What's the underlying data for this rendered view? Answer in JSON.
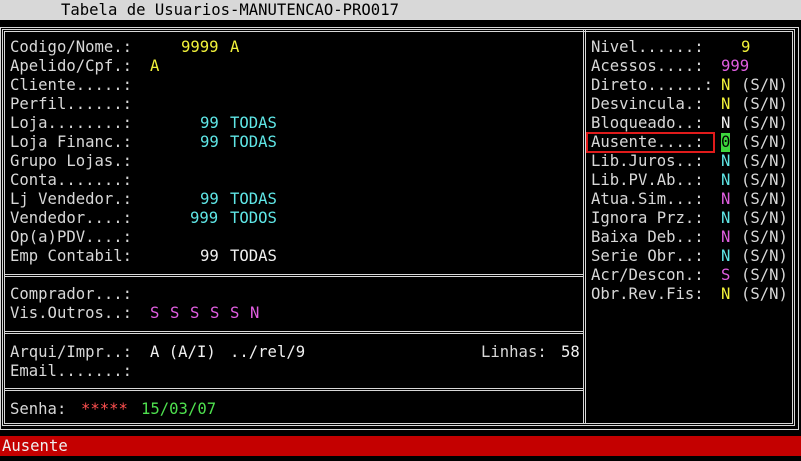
{
  "window": {
    "title": "Tabela de Usuarios-MANUTENCAO-PRO017"
  },
  "left": {
    "fields": [
      {
        "label": "Codigo/Nome.:",
        "value": "9999",
        "value2": "A"
      },
      {
        "label": "Apelido/Cpf.:",
        "value": "A"
      },
      {
        "label": "Cliente.....:"
      },
      {
        "label": "Perfil......:"
      },
      {
        "label": "Loja........:",
        "value": "99",
        "value2": "TODAS"
      },
      {
        "label": "Loja Financ.:",
        "value": "99",
        "value2": "TODAS"
      },
      {
        "label": "Grupo Lojas.:"
      },
      {
        "label": "Conta.......:"
      },
      {
        "label": "Lj Vendedor.:",
        "value": "99",
        "value2": "TODAS"
      },
      {
        "label": "Vendedor....:",
        "value": "999",
        "value2": "TODOS"
      },
      {
        "label": "Op(a)PDV....:"
      },
      {
        "label": "Emp Contabil:",
        "value": "99",
        "value2": "TODAS"
      }
    ],
    "comprador": {
      "label": "Comprador...:"
    },
    "vis_outros": {
      "label": "Vis.Outros..:",
      "values": [
        "S",
        "S",
        "S",
        "S",
        "S",
        "N"
      ]
    },
    "arquivo": {
      "label": "Arqui/Impr..:",
      "value": "A (A/I)",
      "path": "../rel/9"
    },
    "linhas": {
      "label": "Linhas:",
      "value": "58"
    },
    "email": {
      "label": "Email.......:"
    },
    "senha": {
      "label": "Senha:",
      "value": "*****",
      "date": "15/03/07"
    }
  },
  "right": {
    "nivel": {
      "label": "Nivel......:",
      "value": "9"
    },
    "acessos": {
      "label": "Acessos....:",
      "value": "999"
    },
    "flags": [
      {
        "label": "Direto......:",
        "value": "N",
        "options": "(S/N)"
      },
      {
        "label": "Desvincula.:",
        "value": "N",
        "options": "(S/N)"
      },
      {
        "label": "Bloqueado..:",
        "value": "N",
        "options": "(S/N)"
      },
      {
        "label": "Ausente....:",
        "value": "0",
        "options": "(S/N)"
      },
      {
        "label": "Lib.Juros..:",
        "value": "N",
        "options": "(S/N)"
      },
      {
        "label": "Lib.PV.Ab..:",
        "value": "N",
        "options": "(S/N)"
      },
      {
        "label": "Atua.Sim...:",
        "value": "N",
        "options": "(S/N)"
      },
      {
        "label": "Ignora Prz.:",
        "value": "N",
        "options": "(S/N)"
      },
      {
        "label": "Baixa Deb..:",
        "value": "N",
        "options": "(S/N)"
      },
      {
        "label": "Serie Obr..:",
        "value": "N",
        "options": "(S/N)"
      },
      {
        "label": "Acr/Descon.:",
        "value": "S",
        "options": "(S/N)"
      },
      {
        "label": "Obr.Rev.Fis:",
        "value": "N",
        "options": "(S/N)"
      }
    ]
  },
  "status": {
    "message": "Ausente"
  }
}
